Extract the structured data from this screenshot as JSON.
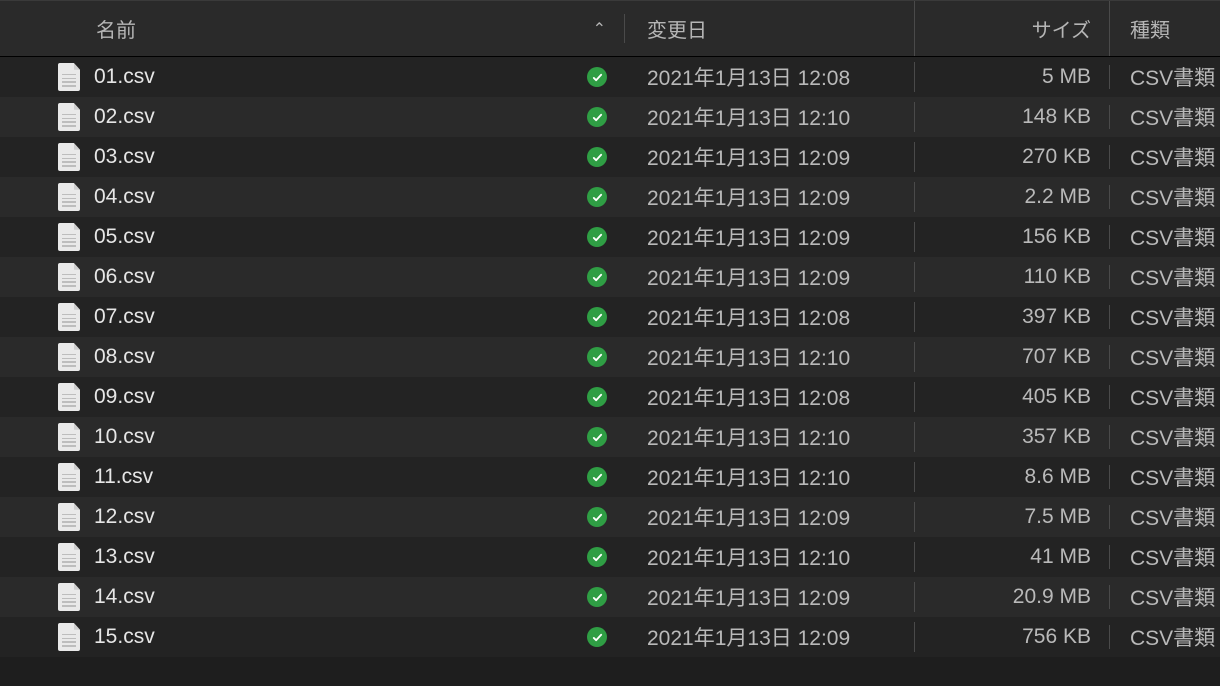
{
  "header": {
    "name": "名前",
    "date": "変更日",
    "size": "サイズ",
    "kind": "種類",
    "sort_caret": "⌃"
  },
  "files": [
    {
      "name": "01.csv",
      "date": "2021年1月13日 12:08",
      "size": "5 MB",
      "kind": "CSV書類"
    },
    {
      "name": "02.csv",
      "date": "2021年1月13日 12:10",
      "size": "148 KB",
      "kind": "CSV書類"
    },
    {
      "name": "03.csv",
      "date": "2021年1月13日 12:09",
      "size": "270 KB",
      "kind": "CSV書類"
    },
    {
      "name": "04.csv",
      "date": "2021年1月13日 12:09",
      "size": "2.2 MB",
      "kind": "CSV書類"
    },
    {
      "name": "05.csv",
      "date": "2021年1月13日 12:09",
      "size": "156 KB",
      "kind": "CSV書類"
    },
    {
      "name": "06.csv",
      "date": "2021年1月13日 12:09",
      "size": "110 KB",
      "kind": "CSV書類"
    },
    {
      "name": "07.csv",
      "date": "2021年1月13日 12:08",
      "size": "397 KB",
      "kind": "CSV書類"
    },
    {
      "name": "08.csv",
      "date": "2021年1月13日 12:10",
      "size": "707 KB",
      "kind": "CSV書類"
    },
    {
      "name": "09.csv",
      "date": "2021年1月13日 12:08",
      "size": "405 KB",
      "kind": "CSV書類"
    },
    {
      "name": "10.csv",
      "date": "2021年1月13日 12:10",
      "size": "357 KB",
      "kind": "CSV書類"
    },
    {
      "name": "11.csv",
      "date": "2021年1月13日 12:10",
      "size": "8.6 MB",
      "kind": "CSV書類"
    },
    {
      "name": "12.csv",
      "date": "2021年1月13日 12:09",
      "size": "7.5 MB",
      "kind": "CSV書類"
    },
    {
      "name": "13.csv",
      "date": "2021年1月13日 12:10",
      "size": "41 MB",
      "kind": "CSV書類"
    },
    {
      "name": "14.csv",
      "date": "2021年1月13日 12:09",
      "size": "20.9 MB",
      "kind": "CSV書類"
    },
    {
      "name": "15.csv",
      "date": "2021年1月13日 12:09",
      "size": "756 KB",
      "kind": "CSV書類"
    }
  ]
}
